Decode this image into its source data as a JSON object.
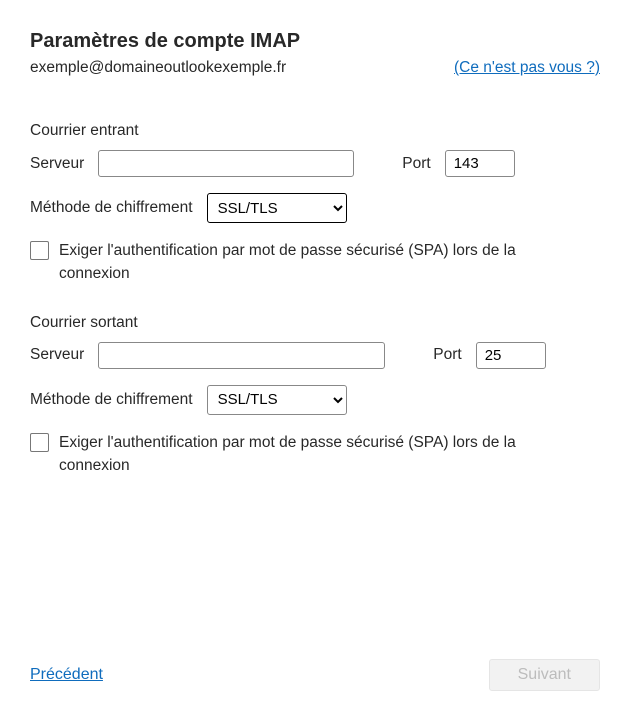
{
  "header": {
    "title": "Paramètres de compte IMAP",
    "email": "exemple@domaineoutlookexemple.fr",
    "not_you_link": "(Ce n'est pas vous ?)"
  },
  "incoming": {
    "heading": "Courrier entrant",
    "server_label": "Serveur",
    "server_value": "",
    "port_label": "Port",
    "port_value": "143",
    "encryption_label": "Méthode de chiffrement",
    "encryption_value": "SSL/TLS",
    "spa_checked": false,
    "spa_label": "Exiger l'authentification par mot de passe sécurisé (SPA) lors de la connexion"
  },
  "outgoing": {
    "heading": "Courrier sortant",
    "server_label": "Serveur",
    "server_value": "",
    "port_label": "Port",
    "port_value": "25",
    "encryption_label": "Méthode de chiffrement",
    "encryption_value": "SSL/TLS",
    "spa_checked": false,
    "spa_label": "Exiger l'authentification par mot de passe sécurisé (SPA) lors de la connexion"
  },
  "footer": {
    "previous": "Précédent",
    "next": "Suivant"
  }
}
